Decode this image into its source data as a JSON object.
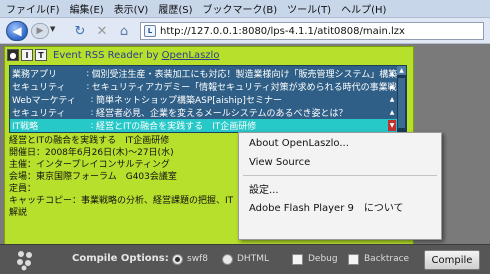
{
  "browser": {
    "menu": [
      "ファイル(F)",
      "編集(E)",
      "表示(V)",
      "履歴(S)",
      "ブックマーク(B)",
      "ツール(T)",
      "ヘルプ(H)"
    ],
    "url": "http://127.0.0.1:8080/lps-4.1.1/atit0808/main.lzx",
    "back_glyph": "◀",
    "forward_glyph": "▶",
    "dropdown_glyph": "▼",
    "reload_glyph": "↻",
    "stop_glyph": "✕",
    "home_glyph": "⌂"
  },
  "app": {
    "header_buttons": [
      "I",
      "T"
    ],
    "title_prefix": "Event RSS Reader by ",
    "title_link": "OpenLaszlo",
    "feed": [
      {
        "category": "業務アプリ",
        "title": "個別受注生産・表装加工にも対応！製造業様向け「販売管理システム」構築セミ"
      },
      {
        "category": "セキュリティ",
        "title": "セキュリティアカデミー「情報セキュリティ対策が求められる時代の事業戦略」"
      },
      {
        "category": "Webマーケティ",
        "title": "簡単ネットショップ構築ASP[aiship]セミナー"
      },
      {
        "category": "セキュリティ",
        "title": "経営者必見、企業を変えるメールシステムのあるべき姿とは？"
      },
      {
        "category": "IT戦略",
        "title": "経営とITの融合を実践する　IT企画研修"
      }
    ],
    "selected_index": 4,
    "detail": [
      "経営とITの融合を実践する　IT企画研修",
      "開催日：2008年6月26日(木)～27日(水)",
      "主催：インタープレイコンサルティング",
      "会場：東京国際フォーラム　G403会議室",
      "定員：",
      "キャッチコピー：事業戦略の分析、経営課題の把握、IT",
      "解説"
    ]
  },
  "context_menu": {
    "items": [
      "About OpenLaszlo...",
      "View Source",
      "設定...",
      "Adobe Flash Player 9　について"
    ]
  },
  "compile_bar": {
    "label": "Compile Options:",
    "options": [
      {
        "label": "swf8",
        "type": "radio",
        "checked": true
      },
      {
        "label": "DHTML",
        "type": "radio",
        "checked": false
      },
      {
        "label": "Debug",
        "type": "checkbox",
        "checked": false
      },
      {
        "label": "Backtrace",
        "type": "checkbox",
        "checked": false
      }
    ],
    "compile_button": "Compile"
  },
  "colors": {
    "app_background": "#b7e02c",
    "feed_background": "#2f5f86",
    "feed_selected": "#27c8c8",
    "title_link": "#2a3d8f"
  }
}
